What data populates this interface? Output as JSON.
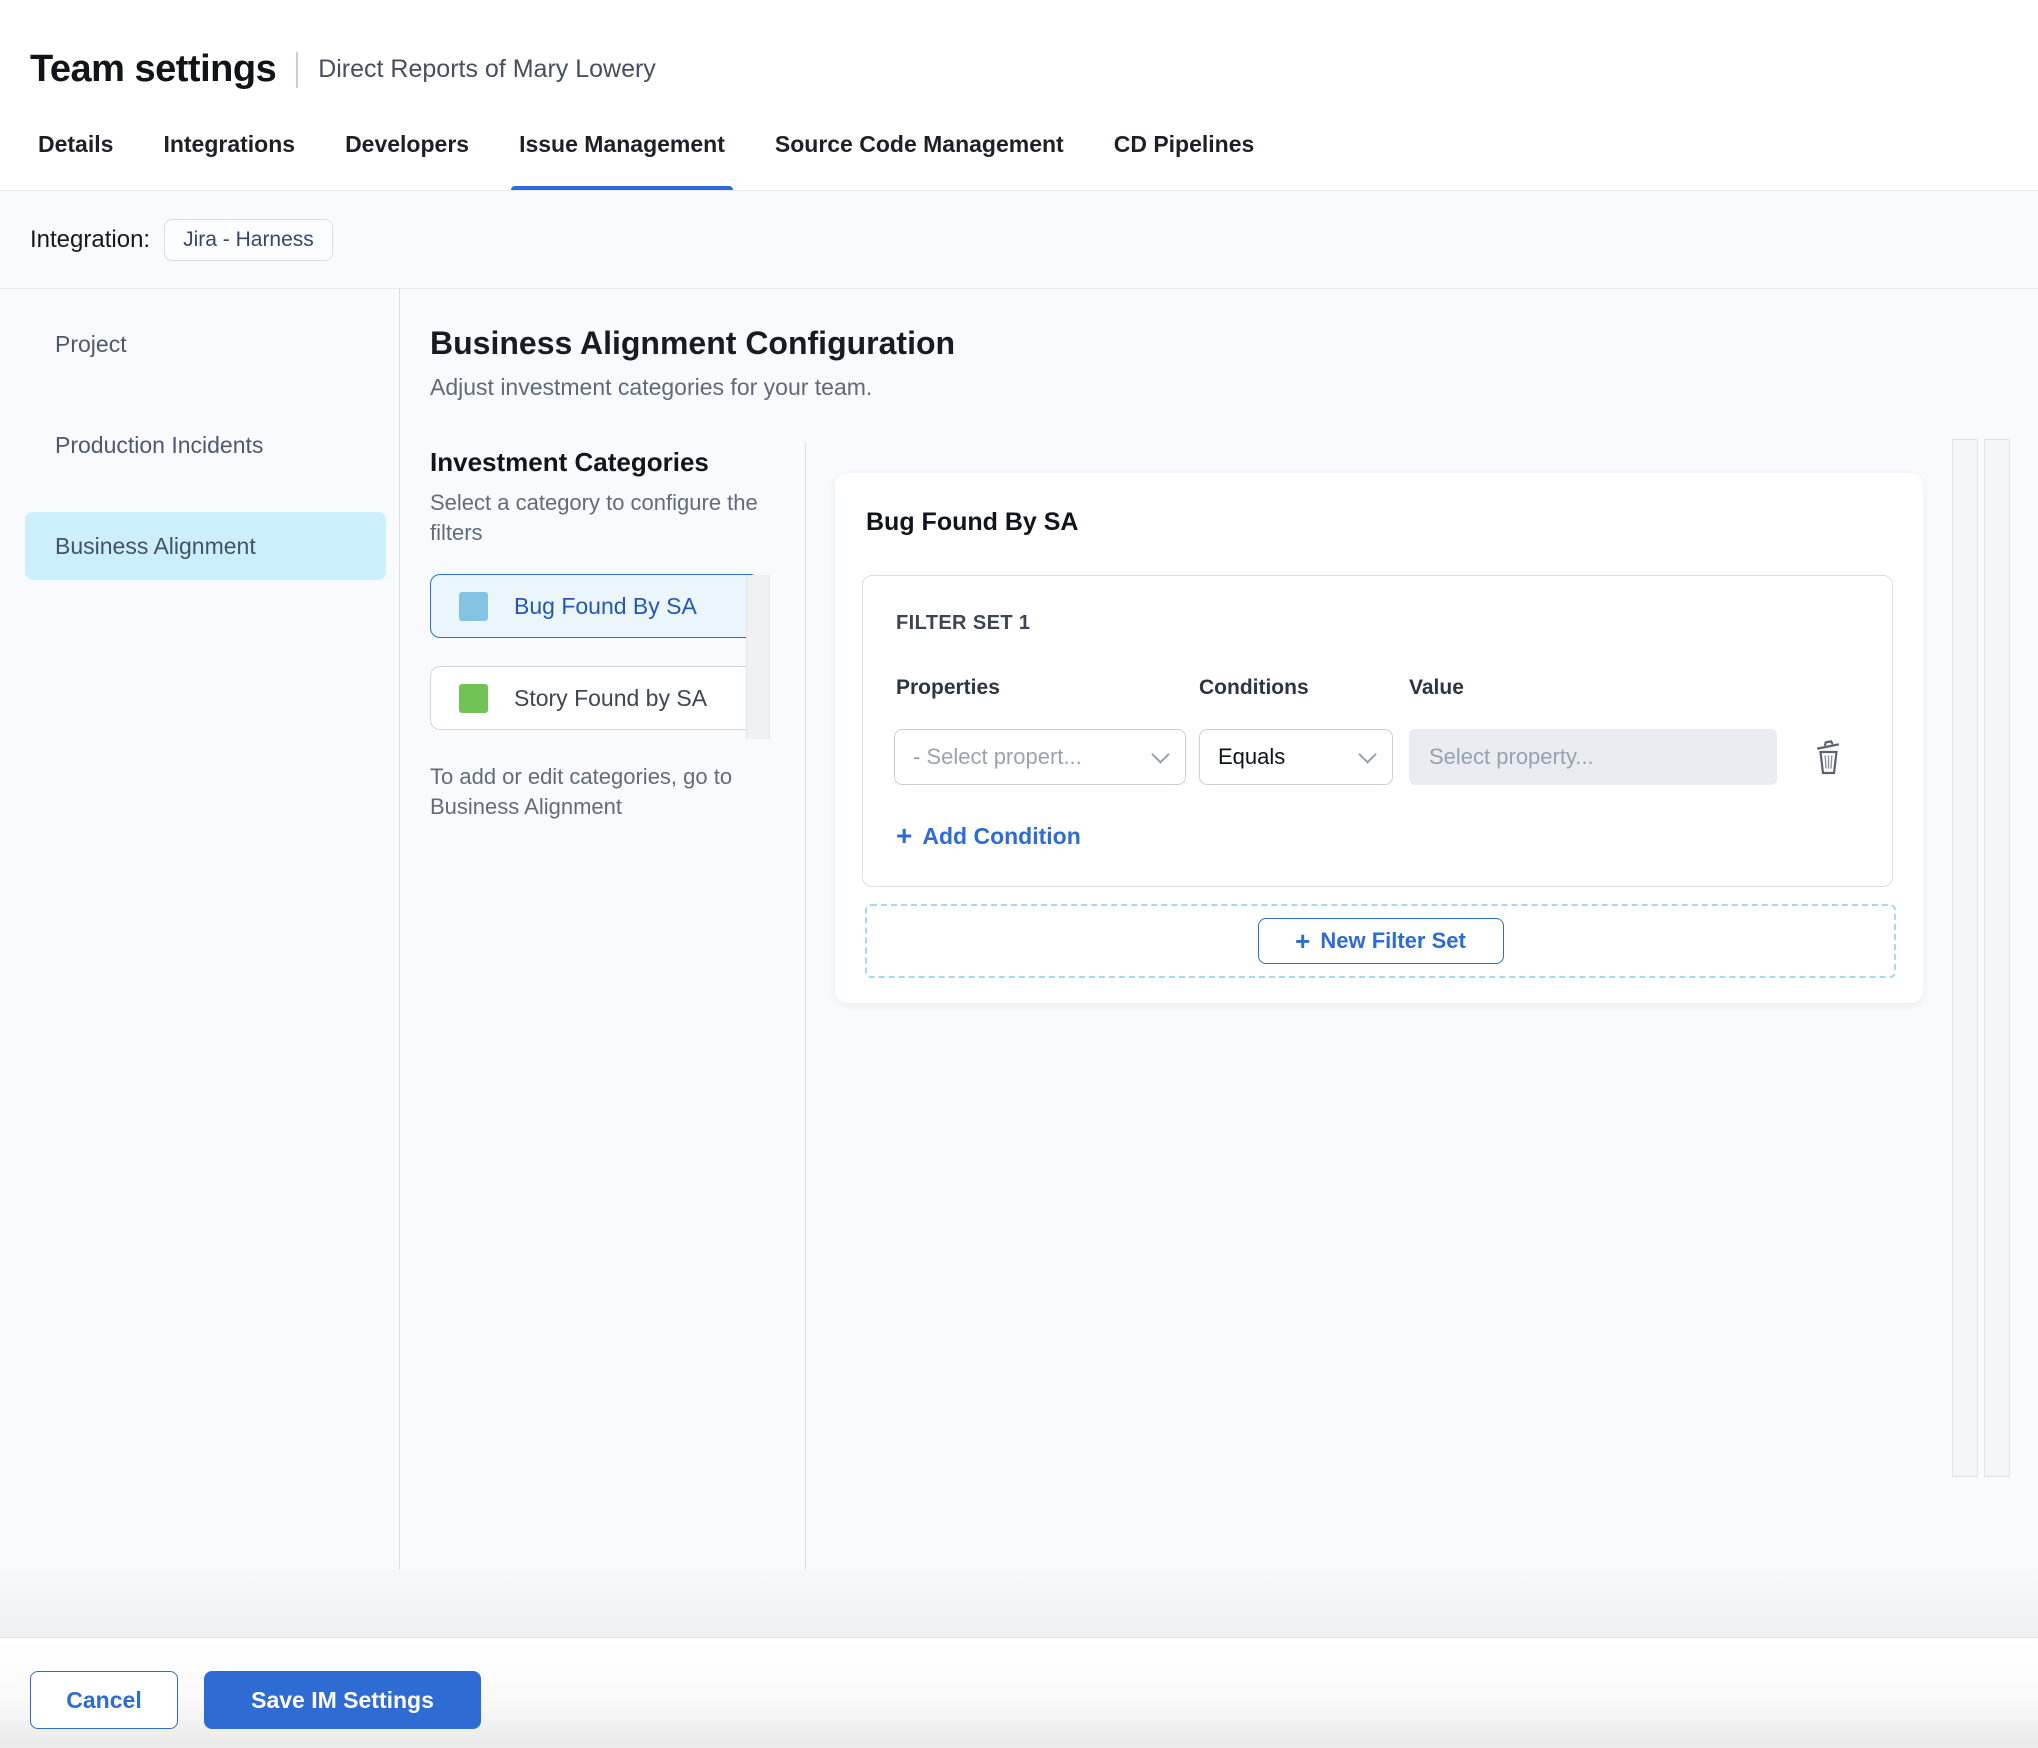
{
  "header": {
    "title": "Team settings",
    "subtitle": "Direct Reports of Mary Lowery"
  },
  "tabs": [
    {
      "label": "Details",
      "active": false
    },
    {
      "label": "Integrations",
      "active": false
    },
    {
      "label": "Developers",
      "active": false
    },
    {
      "label": "Issue Management",
      "active": true
    },
    {
      "label": "Source Code Management",
      "active": false
    },
    {
      "label": "CD Pipelines",
      "active": false
    }
  ],
  "integration": {
    "label": "Integration:",
    "value": "Jira - Harness"
  },
  "sidebar": {
    "items": [
      {
        "label": "Project",
        "active": false
      },
      {
        "label": "Production Incidents",
        "active": false
      },
      {
        "label": "Business Alignment",
        "active": true
      }
    ]
  },
  "main": {
    "title": "Business Alignment Configuration",
    "subtitle": "Adjust investment categories for your team."
  },
  "categories": {
    "heading": "Investment Categories",
    "helper": "Select a category to configure the filters",
    "items": [
      {
        "label": "Bug Found By SA",
        "swatch": "#85c3e2",
        "selected": true
      },
      {
        "label": "Story Found by SA",
        "swatch": "#72c356",
        "selected": false
      }
    ],
    "footnote": "To add or edit categories, go to Business Alignment"
  },
  "panel": {
    "title": "Bug Found By SA",
    "filter_set": {
      "title": "FILTER SET 1",
      "columns": [
        "Properties",
        "Conditions",
        "Value"
      ],
      "property_placeholder": "- Select propert...",
      "condition_value": "Equals",
      "value_placeholder": "Select property...",
      "add_condition_label": "Add Condition"
    },
    "new_filter_set_label": "New Filter Set"
  },
  "footer": {
    "cancel_label": "Cancel",
    "save_label": "Save IM Settings"
  },
  "colors": {
    "accent_blue": "#2e6bd3",
    "active_tab_underline": "#2f6bd8",
    "selected_category_bg": "#ebf6fc",
    "selected_category_border": "#2f6bd8",
    "sidebar_active_bg": "#cbeffd",
    "content_bg": "#f8fafd",
    "value_input_bg": "#e9edf2",
    "dashed_border": "#a9d8ee"
  }
}
